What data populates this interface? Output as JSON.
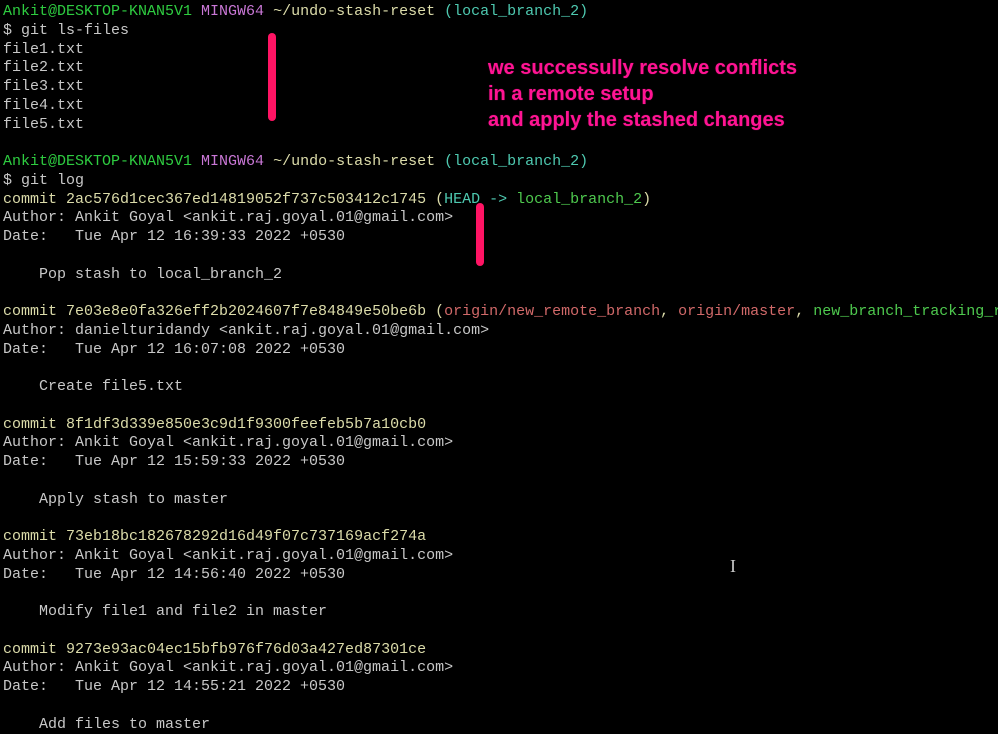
{
  "prompt1": {
    "user": "Ankit@DESKTOP-KNAN5V1",
    "env": "MINGW64",
    "path": "~/undo-stash-reset",
    "branch": "(local_branch_2)"
  },
  "cmd1": "$ git ls-files",
  "files": [
    "file1.txt",
    "file2.txt",
    "file3.txt",
    "file4.txt",
    "file5.txt"
  ],
  "blank1": " ",
  "prompt2": {
    "user": "Ankit@DESKTOP-KNAN5V1",
    "env": "MINGW64",
    "path": "~/undo-stash-reset",
    "branch": "(local_branch_2)"
  },
  "cmd2": "$ git log",
  "commits": [
    {
      "hash_prefix": "commit ",
      "hash": "2ac576d1cec367ed14819052f737c503412c1745",
      "refs_open": " (",
      "head": "HEAD -> ",
      "branch": "local_branch_2",
      "refs_close": ")",
      "author": "Author: Ankit Goyal <ankit.raj.goyal.01@gmail.com>",
      "date": "Date:   Tue Apr 12 16:39:33 2022 +0530",
      "blank": " ",
      "msg": "    Pop stash to local_branch_2",
      "blank2": " "
    },
    {
      "hash_prefix": "commit ",
      "hash": "7e03e8e0fa326eff2b2024607f7e84849e50be6b",
      "refs_open": " (",
      "remote1": "origin/new_remote_branch",
      "sep1": ", ",
      "remote2": "origin/master",
      "sep2": ", ",
      "local": "new_branch_tracking_r",
      "author": "Author: danielturidandy <ankit.raj.goyal.01@gmail.com>",
      "date": "Date:   Tue Apr 12 16:07:08 2022 +0530",
      "blank": " ",
      "msg": "    Create file5.txt",
      "blank2": " "
    },
    {
      "hash_prefix": "commit ",
      "hash": "8f1df3d339e850e3c9d1f9300feefeb5b7a10cb0",
      "author": "Author: Ankit Goyal <ankit.raj.goyal.01@gmail.com>",
      "date": "Date:   Tue Apr 12 15:59:33 2022 +0530",
      "blank": " ",
      "msg": "    Apply stash to master",
      "blank2": " "
    },
    {
      "hash_prefix": "commit ",
      "hash": "73eb18bc182678292d16d49f07c737169acf274a",
      "author": "Author: Ankit Goyal <ankit.raj.goyal.01@gmail.com>",
      "date": "Date:   Tue Apr 12 14:56:40 2022 +0530",
      "blank": " ",
      "msg": "    Modify file1 and file2 in master",
      "blank2": " "
    },
    {
      "hash_prefix": "commit ",
      "hash": "9273e93ac04ec15bfb976f76d03a427ed87301ce",
      "author": "Author: Ankit Goyal <ankit.raj.goyal.01@gmail.com>",
      "date": "Date:   Tue Apr 12 14:55:21 2022 +0530",
      "blank": " ",
      "msg": "    Add files to master"
    }
  ],
  "annotation": {
    "line1": "we successully resolve conflicts",
    "line2": "in a remote setup",
    "line3": "and apply the stashed changes"
  },
  "cursor": "I"
}
